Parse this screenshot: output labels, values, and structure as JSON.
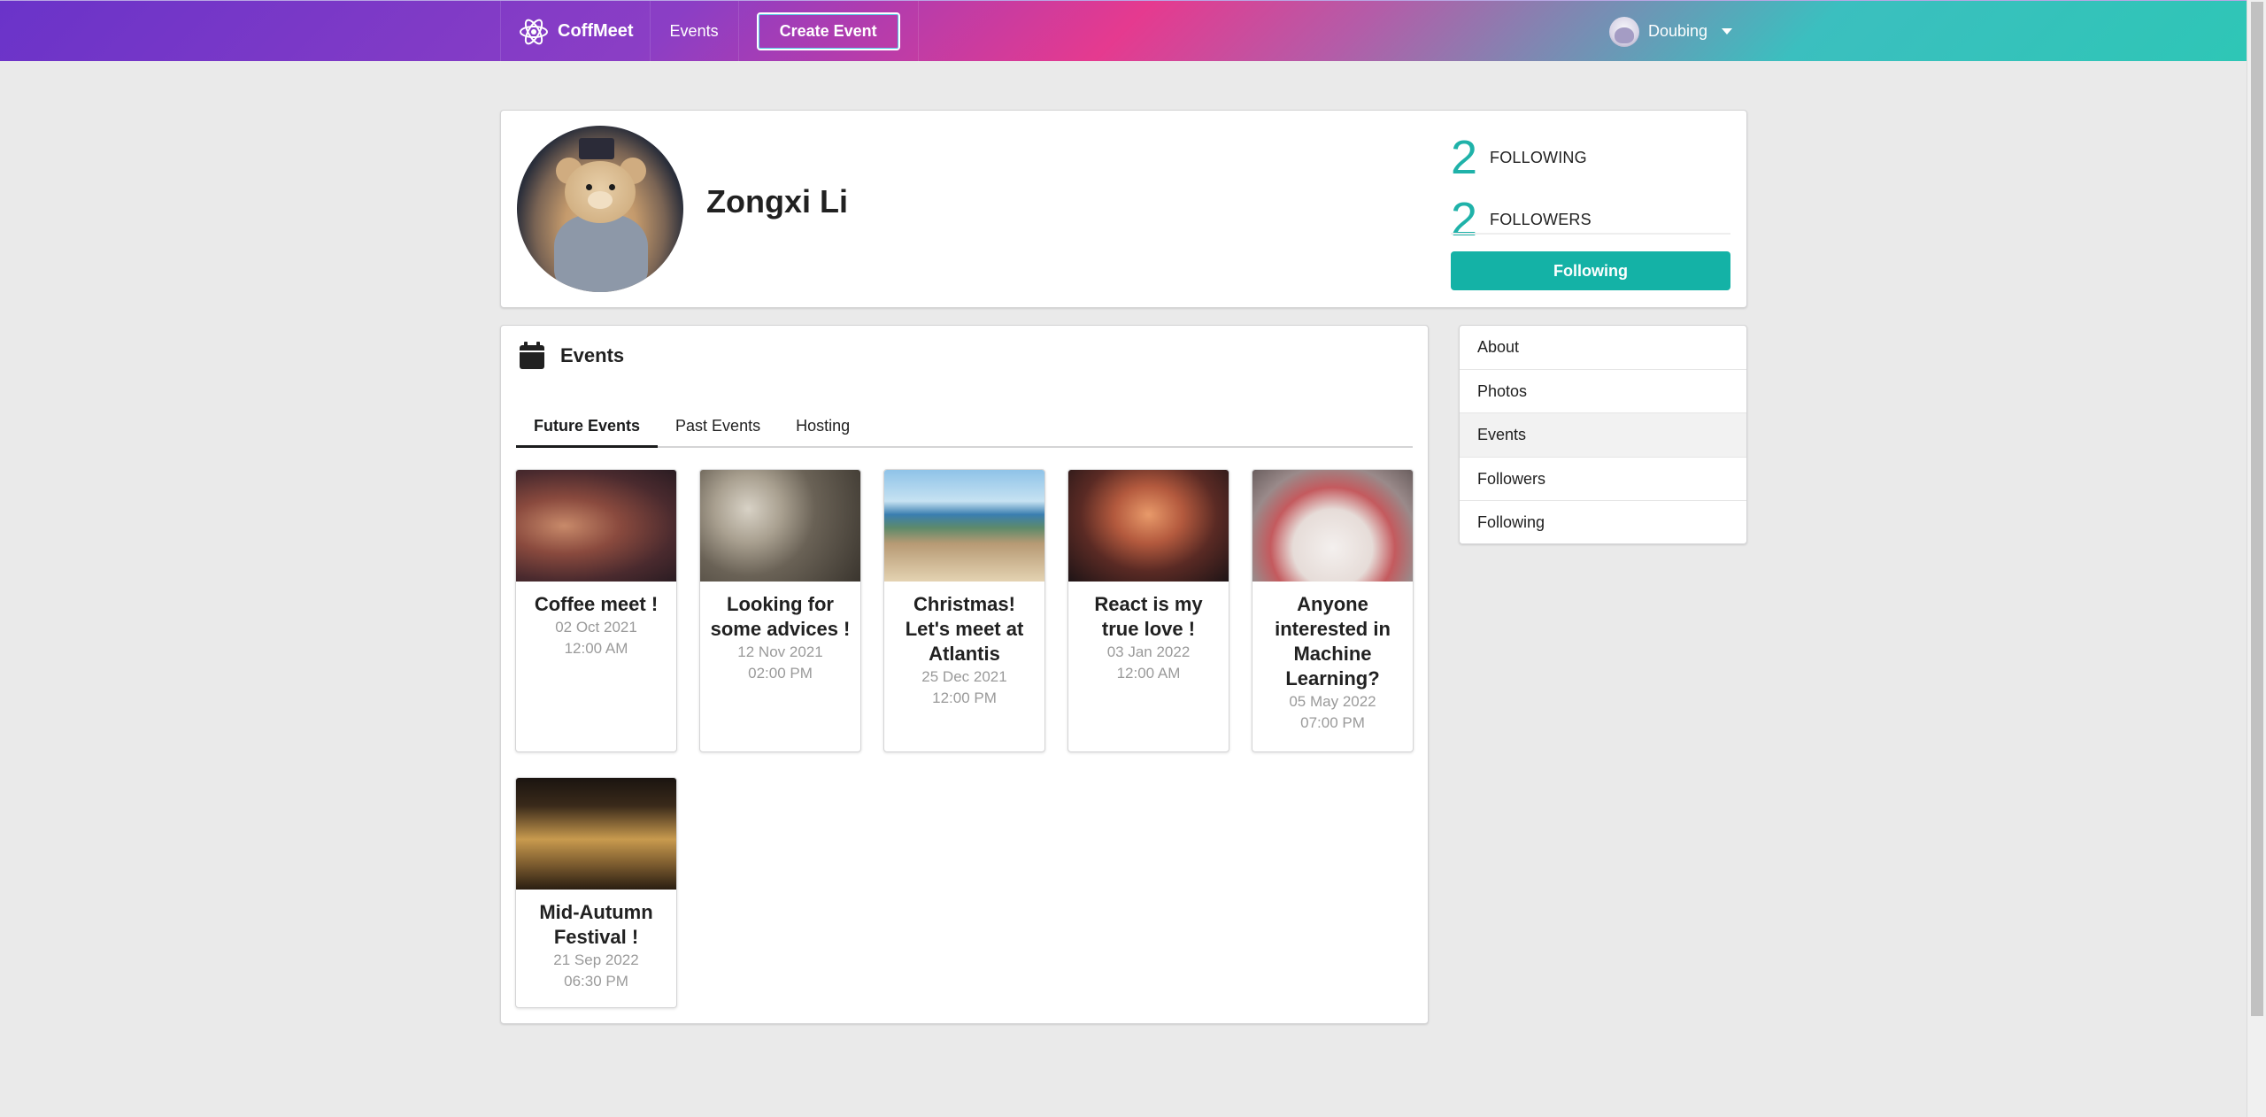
{
  "nav": {
    "brand": "CoffMeet",
    "events_link": "Events",
    "create_event": "Create Event",
    "user_name": "Doubing"
  },
  "profile": {
    "name": "Zongxi Li",
    "following_count": "2",
    "following_label": "FOLLOWING",
    "followers_count": "2",
    "followers_label": "FOLLOWERS",
    "follow_button": "Following"
  },
  "events_panel": {
    "title": "Events",
    "tabs": [
      "Future Events",
      "Past Events",
      "Hosting"
    ],
    "active_tab": "Future Events",
    "cards": [
      {
        "title": "Coffee meet !",
        "date": "02 Oct 2021",
        "time": "12:00 AM",
        "image": "wine-glasses-photo"
      },
      {
        "title": "Looking for some advices !",
        "date": "12 Nov 2021",
        "time": "02:00 PM",
        "image": "film-reels-photo"
      },
      {
        "title": "Christmas! Let's meet at Atlantis",
        "date": "25 Dec 2021",
        "time": "12:00 PM",
        "image": "beach-photo"
      },
      {
        "title": "React is my true love !",
        "date": "03 Jan 2022",
        "time": "12:00 AM",
        "image": "concert-crowd-photo"
      },
      {
        "title": "Anyone interested in Machine Learning?",
        "date": "05 May 2022",
        "time": "07:00 PM",
        "image": "banquet-table-photo"
      },
      {
        "title": "Mid-Autumn Festival !",
        "date": "21 Sep 2022",
        "time": "06:30 PM",
        "image": "louvre-pyramid-photo"
      }
    ]
  },
  "side_menu": {
    "items": [
      "About",
      "Photos",
      "Events",
      "Followers",
      "Following"
    ],
    "active": "Events"
  },
  "colors": {
    "accent_teal": "#14b2a6",
    "count_teal": "#1fb2a9",
    "nav_gradient_start": "#6a33c9",
    "nav_gradient_mid": "#e53a8f",
    "nav_gradient_end": "#2ec6b6"
  }
}
